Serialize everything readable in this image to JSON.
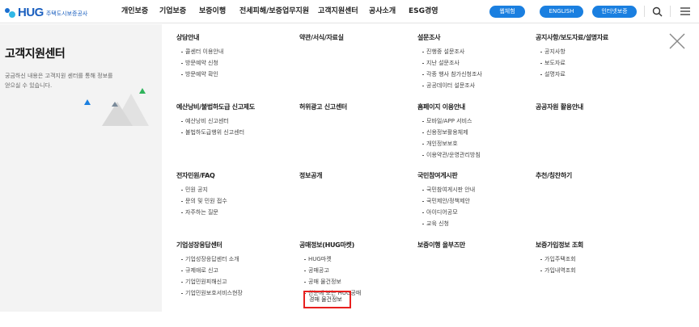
{
  "logo": {
    "text": "HUG",
    "sub": "주택도시보증공사"
  },
  "gnb": [
    "개인보증",
    "기업보증",
    "보증이행",
    "전세피해/보증업무지원",
    "고객지원센터",
    "공사소개",
    "ESG경영"
  ],
  "pills": [
    "웹체험",
    "ENGLISH",
    "인터넷보증"
  ],
  "panel": {
    "title": "고객지원센터",
    "desc": "궁금하신 내용은 고객지원 센터를 통해 정보를 얻으실 수 있습니다."
  },
  "groups": [
    {
      "title": "상담안내",
      "items": [
        "콜센터 이용안내",
        "방문예약 신청",
        "방문예약 확인"
      ]
    },
    {
      "title": "약관/서식/자료실",
      "items": []
    },
    {
      "title": "설문조사",
      "items": [
        "진행중 설문조사",
        "지난 설문조사",
        "각종 행사 참가신청조사",
        "공공데이터 설문조사"
      ]
    },
    {
      "title": "공지사항/보도자료/설명자료",
      "items": [
        "공지사항",
        "보도자료",
        "설명자료"
      ]
    },
    {
      "title": "예산낭비/불법하도급 신고제도",
      "items": [
        "예산낭비 신고센터",
        "불법하도급행위 신고센터"
      ]
    },
    {
      "title": "허위광고 신고센터",
      "items": []
    },
    {
      "title": "홈페이지 이용안내",
      "items": [
        "모바일/APP 서비스",
        "신용정보활용체제",
        "개인정보보호",
        "이용약관/운영관리방침"
      ]
    },
    {
      "title": "공공자원 활용안내",
      "items": []
    },
    {
      "title": "전자민원/FAQ",
      "items": [
        "민원 공지",
        "문의 및 민원 접수",
        "자주하는 질문"
      ]
    },
    {
      "title": "정보공개",
      "items": []
    },
    {
      "title": "국민참여게시판",
      "items": [
        "국민참여게시판 안내",
        "국민제안/정책제안",
        "아이디어공모",
        "교육 신청"
      ]
    },
    {
      "title": "추천/칭찬하기",
      "items": []
    },
    {
      "title": "기업성장응답센터",
      "items": [
        "기업성장응답센터 소개",
        "규제애로 신고",
        "기업민원피해신고",
        "기업민원보호서비스현장"
      ]
    },
    {
      "title": "공매정보(HUG마켓)",
      "items": [
        "HUG마켓",
        "공매공고",
        "공매 물건정보",
        "한눈에 보는 HUG공매"
      ]
    },
    {
      "title": "보증이행 올부즈만",
      "items": []
    },
    {
      "title": "보증가입정보 조회",
      "items": [
        "가입주택조회",
        "가입내역조회"
      ]
    }
  ],
  "highlight": {
    "label": "경매 물건정보"
  },
  "colors": {
    "accent": "#1a7fe0",
    "highlight": "#e8201f"
  },
  "icons": [
    "search-icon",
    "hamburger-icon",
    "close-icon"
  ]
}
